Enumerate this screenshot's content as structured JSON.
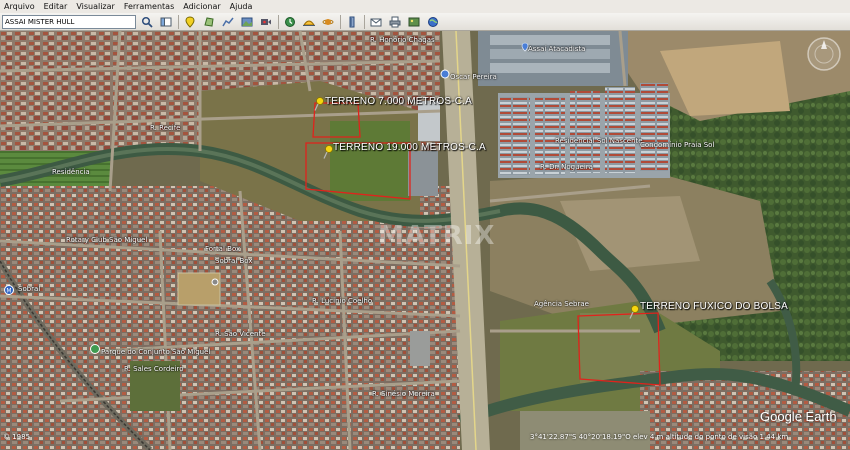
{
  "menu": [
    {
      "label": "Arquivo"
    },
    {
      "label": "Editar"
    },
    {
      "label": "Visualizar"
    },
    {
      "label": "Ferramentas"
    },
    {
      "label": "Adicionar"
    },
    {
      "label": "Ajuda"
    }
  ],
  "toolbar": {
    "search_value": "ASSAI MISTER HULL",
    "icons": [
      "search-icon",
      "sidebar-toggle-icon",
      "placemark-icon",
      "polygon-icon",
      "path-icon",
      "image-overlay-icon",
      "record-tour-icon",
      "historical-imagery-icon",
      "sunlight-icon",
      "planets-icon",
      "ruler-icon",
      "email-icon",
      "print-icon",
      "save-image-icon",
      "map-view-icon"
    ]
  },
  "map": {
    "pins": [
      {
        "label": "TERRENO 7.000 METROS-C.A"
      },
      {
        "label": "TERRENO 19.000 METROS-C.A"
      },
      {
        "label": "TERRENO FUXICO DO BOLSA"
      }
    ],
    "labels": [
      {
        "text": "Assaí Atacadista"
      },
      {
        "text": "Oscar Pereira"
      },
      {
        "text": "Residencial Sol Nascente"
      },
      {
        "text": "Condomínio Praia Sol"
      },
      {
        "text": "R. Dr. Nogueira"
      },
      {
        "text": "Rotary Club São Miguel"
      },
      {
        "text": "Fortal Box"
      },
      {
        "text": "Sobral Box"
      },
      {
        "text": "Agência Sebrae"
      },
      {
        "text": "R. Lucinio Coelho"
      },
      {
        "text": "Parque do Conjunto São Miguel"
      },
      {
        "text": "R. São Vicente"
      },
      {
        "text": "R. Recife"
      },
      {
        "text": "R. Sinésio Moreira"
      },
      {
        "text": "R. Sales Cordeiro"
      },
      {
        "text": "R. Honório Chagas"
      },
      {
        "text": "Sobral"
      },
      {
        "text": "Residência"
      }
    ],
    "watermark": "MATRIX",
    "imagery_year": "© 1985",
    "status": "3°41'22.87\"S  40°20'18.19\"O  elev  4 m  altitude do ponto de visão  1.44 km",
    "logo": "Google Earth"
  }
}
